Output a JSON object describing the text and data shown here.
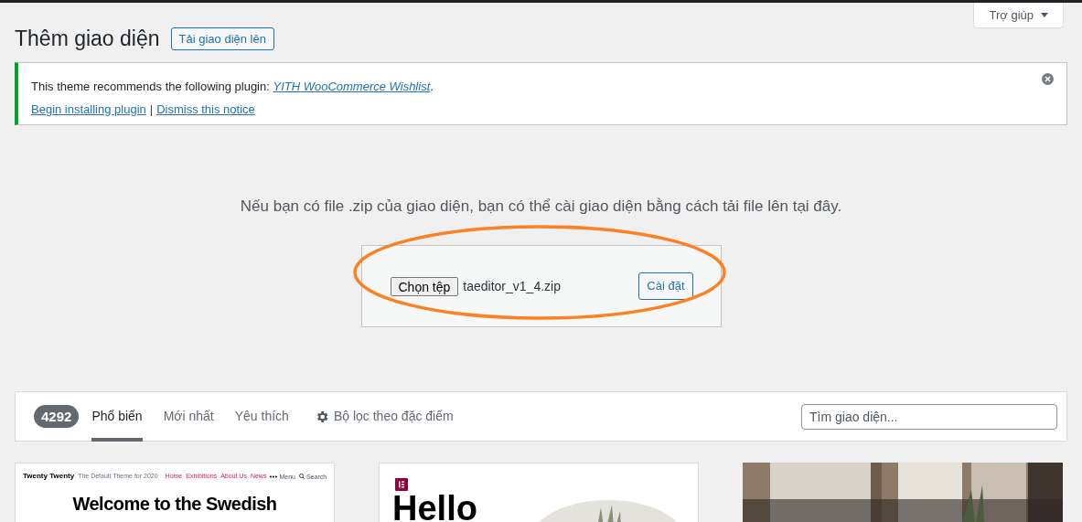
{
  "help_tab": {
    "label": "Trợ giúp"
  },
  "page_title": "Thêm giao diện",
  "upload_toggle": "Tải giao diện lên",
  "notice": {
    "text": "This theme recommends the following plugin: ",
    "plugin_link": "YITH WooCommerce Wishlist",
    "text_end": ".",
    "links": [
      "Begin installing plugin",
      "Dismiss this notice"
    ],
    "separator": "|"
  },
  "upload": {
    "description": "Nếu bạn có file .zip của giao diện, bạn có thể cài giao diện bằng cách tải file lên tại đây.",
    "choose_button": "Chọn tệp",
    "file_name": "taeditor_v1_4.zip",
    "install_button": "Cài đặt",
    "highlighted": true
  },
  "filter_bar": {
    "count": "4292",
    "tabs": [
      {
        "label": "Phổ biến",
        "selected": true
      },
      {
        "label": "Mới nhất",
        "selected": false
      },
      {
        "label": "Yêu thích",
        "selected": false
      }
    ],
    "feature_filter": "Bộ lọc theo đặc điểm",
    "search": {
      "placeholder": "Tìm giao diện..."
    }
  },
  "themes": [
    {
      "kind": "twenty-twenty",
      "site_title": "Twenty Twenty",
      "tagline": "The Default Theme for 2020",
      "nav": [
        "Home",
        "Exhibitions",
        "About Us",
        "News"
      ],
      "menu_label": "Menu",
      "search_label": "Search",
      "headline": "Welcome to the Swedish"
    },
    {
      "kind": "hello",
      "headline": "Hello"
    },
    {
      "kind": "picture"
    }
  ]
}
